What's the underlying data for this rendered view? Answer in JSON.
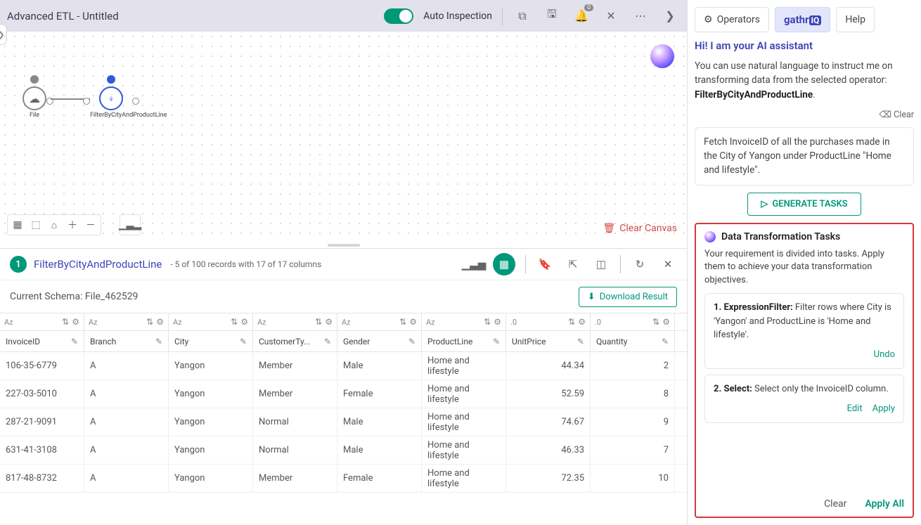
{
  "topbar": {
    "title": "Advanced ETL - Untitled",
    "auto_inspection": "Auto Inspection",
    "bell_badge": "0"
  },
  "canvas": {
    "nodes": [
      {
        "id": "file",
        "label": "File"
      },
      {
        "id": "filter",
        "label": "FilterByCityAndProductLine"
      }
    ],
    "clear_label": "Clear Canvas"
  },
  "panel": {
    "step": "1",
    "title": "FilterByCityAndProductLine",
    "subtitle": "- 5 of 100 records with 17 of 17 columns",
    "schema_label": "Current Schema: File_462529",
    "download_label": "Download Result"
  },
  "table": {
    "columns": [
      "InvoiceID",
      "Branch",
      "City",
      "CustomerTy...",
      "Gender",
      "ProductLine",
      "UnitPrice",
      "Quantity"
    ],
    "types": [
      "Aᴢ",
      "Aᴢ",
      "Aᴢ",
      "Aᴢ",
      "Aᴢ",
      "Aᴢ",
      ".0",
      ".0"
    ],
    "rows": [
      [
        "106-35-6779",
        "A",
        "Yangon",
        "Member",
        "Male",
        "Home and lifestyle",
        "44.34",
        "2"
      ],
      [
        "227-03-5010",
        "A",
        "Yangon",
        "Member",
        "Female",
        "Home and lifestyle",
        "52.59",
        "8"
      ],
      [
        "287-21-9091",
        "A",
        "Yangon",
        "Normal",
        "Male",
        "Home and lifestyle",
        "74.67",
        "9"
      ],
      [
        "631-41-3108",
        "A",
        "Yangon",
        "Normal",
        "Male",
        "Home and lifestyle",
        "46.33",
        "7"
      ],
      [
        "817-48-8732",
        "A",
        "Yangon",
        "Member",
        "Female",
        "Home and lifestyle",
        "72.35",
        "10"
      ]
    ]
  },
  "side": {
    "tab_operators": "Operators",
    "tab_gathr": "gathr",
    "tab_help": "Help",
    "greet": "Hi! I am your AI assistant",
    "intro_a": "You can use natural language to instruct me on transforming data from the selected operator: ",
    "intro_b": "FilterByCityAndProductLine",
    "clear": "Clear",
    "prompt": "Fetch InvoiceID of all the purchases made in the City of Yangon under ProductLine \"Home and lifestyle\".",
    "generate": "GENERATE TASKS",
    "tasks_title": "Data Transformation Tasks",
    "tasks_desc": "Your requirement is divided into tasks. Apply them to achieve your data transformation objectives.",
    "task1_label": "1. ExpressionFilter:",
    "task1_body": " Filter rows where City is 'Yangon' and ProductLine is 'Home and lifestyle'.",
    "task1_action": "Undo",
    "task2_label": "2. Select:",
    "task2_body": " Select only the InvoiceID column.",
    "task2_edit": "Edit",
    "task2_apply": "Apply",
    "footer_clear": "Clear",
    "footer_apply": "Apply All"
  }
}
